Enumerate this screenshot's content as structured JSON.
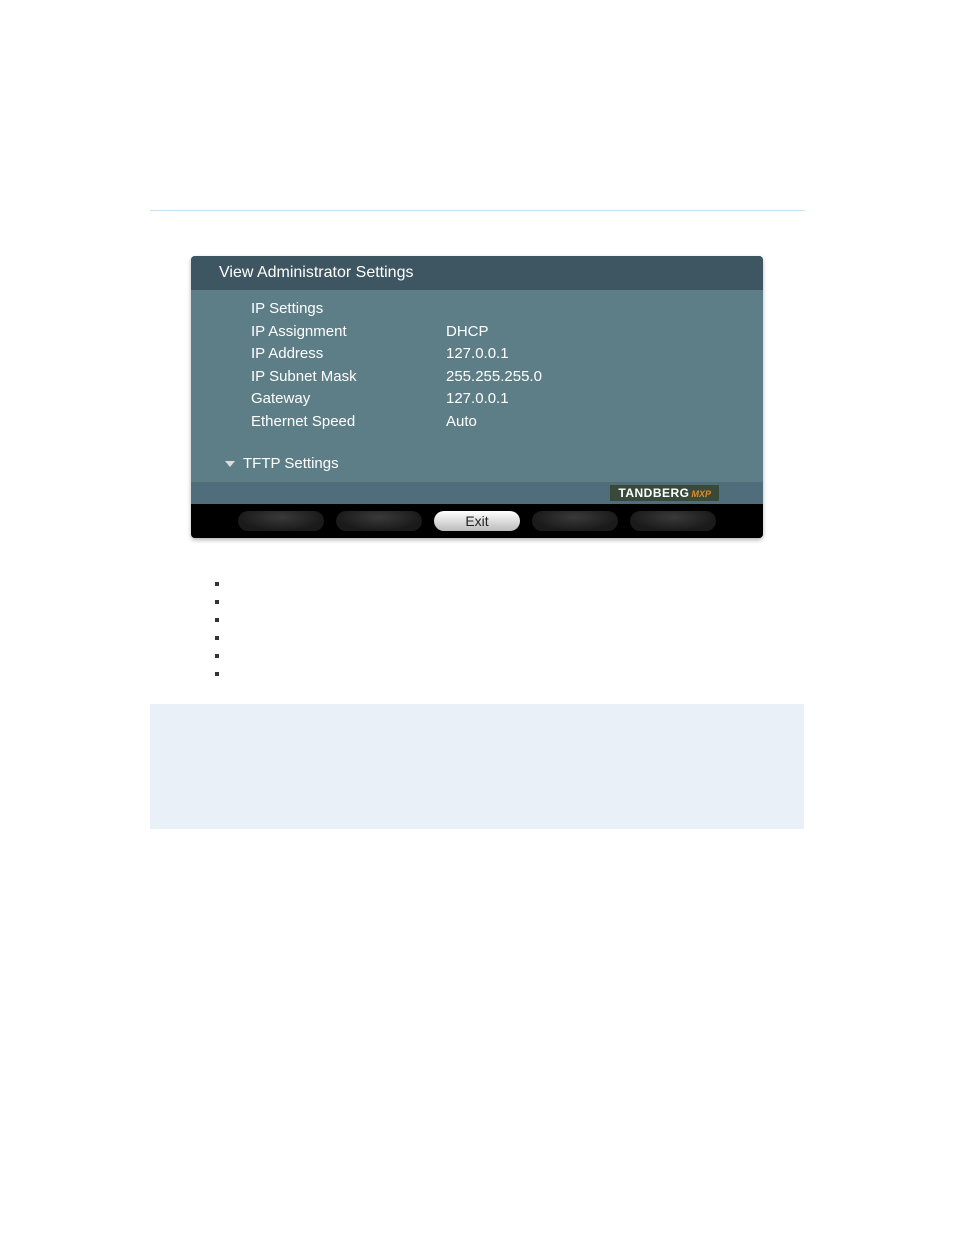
{
  "panel": {
    "header": "View Administrator Settings",
    "section_title": "IP Settings",
    "rows": [
      {
        "label": "IP Assignment",
        "value": "DHCP"
      },
      {
        "label": "IP Address",
        "value": "127.0.0.1"
      },
      {
        "label": "IP Subnet Mask",
        "value": "255.255.255.0"
      },
      {
        "label": "Gateway",
        "value": "127.0.0.1"
      },
      {
        "label": "Ethernet Speed",
        "value": "Auto"
      }
    ],
    "collapse_label": "TFTP Settings",
    "brand_main": "TANDBERG",
    "brand_sub": "MXP",
    "exit_label": "Exit"
  }
}
